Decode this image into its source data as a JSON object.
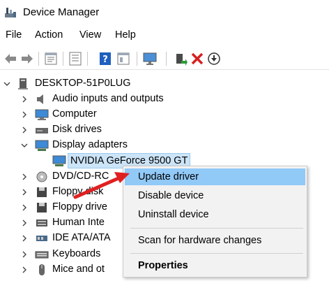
{
  "window": {
    "title": "Device Manager"
  },
  "menu": [
    "File",
    "Action",
    "View",
    "Help"
  ],
  "toolbar": {
    "icons": [
      "back-arrow-icon",
      "forward-arrow-icon",
      "properties-icon",
      "list-icon",
      "help-icon",
      "view-icon",
      "monitor-icon",
      "add-driver-icon",
      "uninstall-x-icon",
      "download-circle-icon"
    ]
  },
  "tree": {
    "root": "DESKTOP-51P0LUG",
    "items": [
      {
        "label": "Audio inputs and outputs",
        "icon": "speaker-icon"
      },
      {
        "label": "Computer",
        "icon": "computer-icon"
      },
      {
        "label": "Disk drives",
        "icon": "disk-drive-icon"
      },
      {
        "label": "Display adapters",
        "icon": "display-adapter-icon"
      },
      {
        "label": "NVIDIA GeForce 9500 GT",
        "icon": "display-adapter-icon"
      },
      {
        "label": "DVD/CD-RC",
        "icon": "dvd-drive-icon"
      },
      {
        "label": "Floppy disk",
        "icon": "floppy-disk-icon"
      },
      {
        "label": "Floppy drive",
        "icon": "floppy-drive-icon"
      },
      {
        "label": "Human Inte",
        "icon": "hid-icon"
      },
      {
        "label": "IDE ATA/ATA",
        "icon": "ide-controller-icon"
      },
      {
        "label": "Keyboards",
        "icon": "keyboard-icon"
      },
      {
        "label": "Mice and ot",
        "icon": "mouse-icon"
      }
    ]
  },
  "context_menu": {
    "items": [
      "Update driver",
      "Disable device",
      "Uninstall device",
      "Scan for hardware changes",
      "Properties"
    ]
  },
  "colors": {
    "selection_bg": "#cce4f7",
    "menu_hover": "#91c9f7",
    "arrow": "#e02020"
  }
}
